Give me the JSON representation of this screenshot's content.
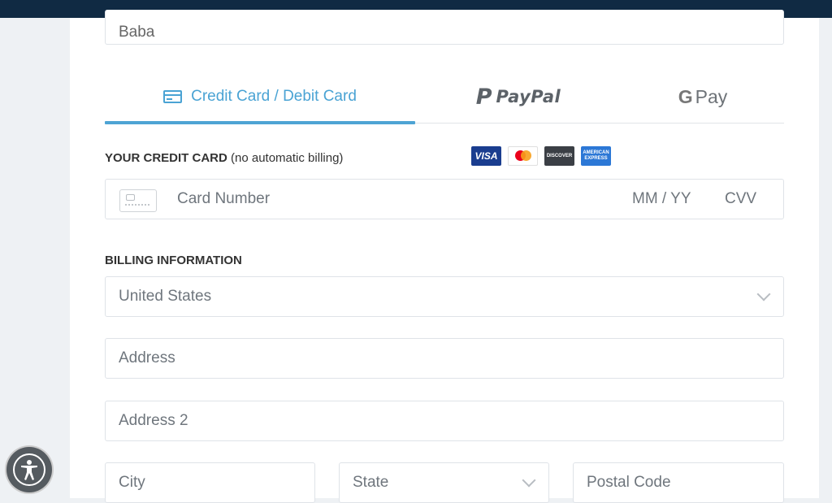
{
  "form": {
    "name_value": "Baba",
    "tabs": [
      {
        "label": "Credit Card / Debit Card"
      },
      {
        "label": "PayPal"
      },
      {
        "label": "Pay",
        "prefix": "G"
      }
    ],
    "credit_section": {
      "heading": "YOUR CREDIT CARD",
      "note": "(no automatic billing)"
    },
    "card_logos": [
      {
        "name": "visa-logo",
        "text": "VISA"
      },
      {
        "name": "mastercard-logo",
        "text": ""
      },
      {
        "name": "discover-logo",
        "text": "DISCOVER"
      },
      {
        "name": "amex-logo",
        "text": "AMERICAN EXPRESS"
      }
    ],
    "card_number_placeholder": "Card Number",
    "expiry_placeholder": "MM / YY",
    "cvv_placeholder": "CVV",
    "billing_heading": "BILLING INFORMATION",
    "country_value": "United States",
    "address_placeholder": "Address",
    "address2_placeholder": "Address 2",
    "city_placeholder": "City",
    "state_placeholder": "State",
    "postal_placeholder": "Postal Code"
  },
  "colors": {
    "accent": "#4aa3d4",
    "topbar": "#102a43"
  },
  "icons": {
    "accessibility": "accessibility-icon",
    "card": "credit-card-icon",
    "chevron": "chevron-down-icon"
  }
}
